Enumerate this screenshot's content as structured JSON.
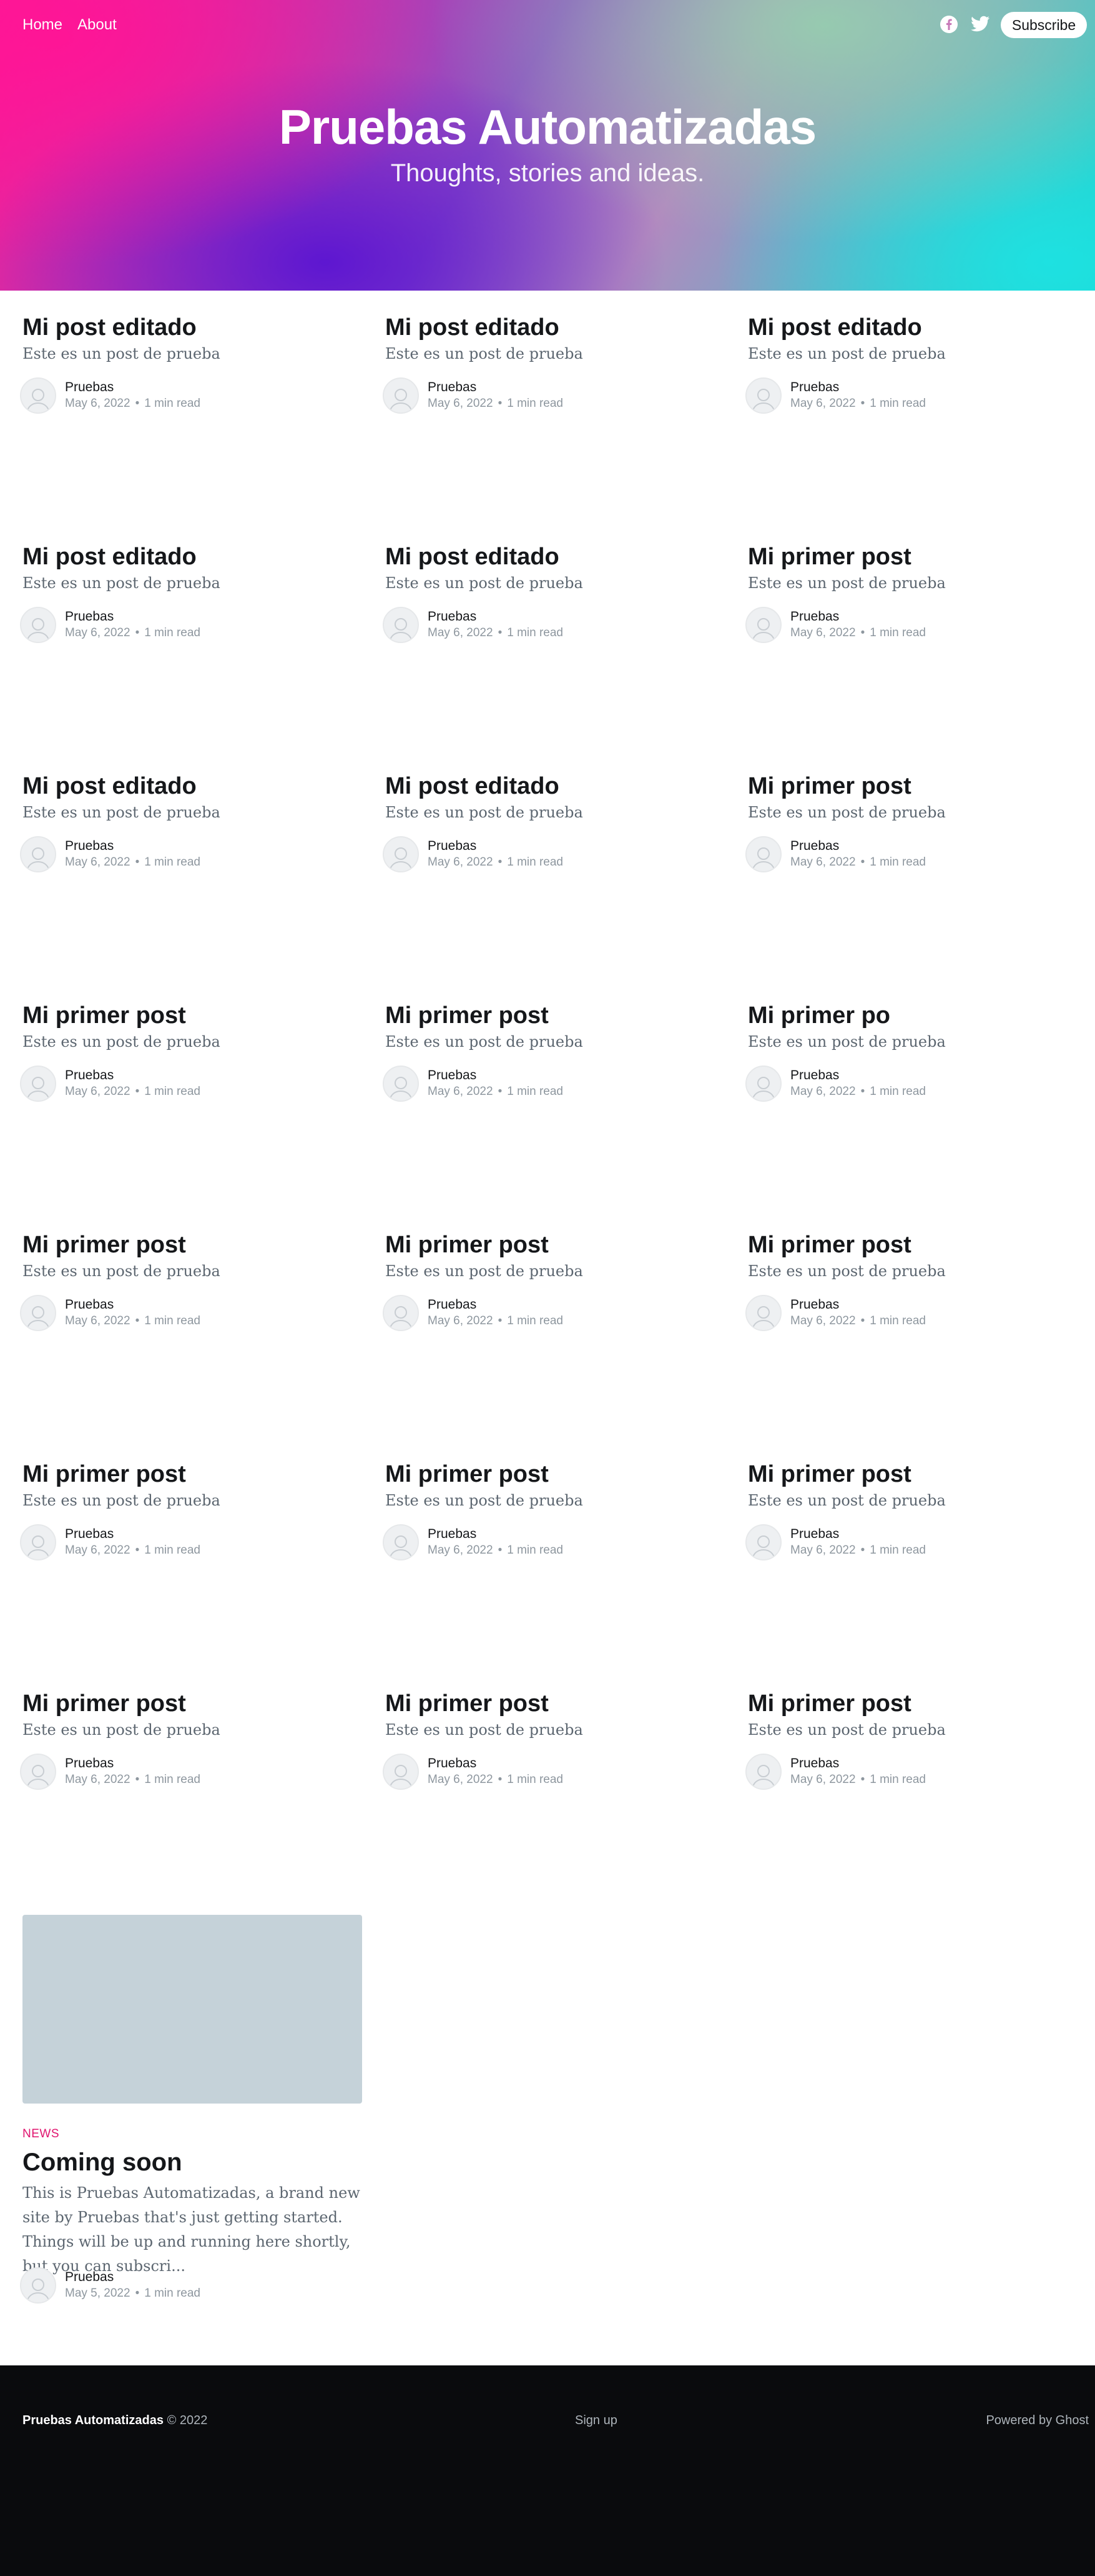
{
  "header": {
    "nav": [
      "Home",
      "About"
    ],
    "social_icons": [
      "facebook-icon",
      "twitter-icon"
    ],
    "subscribe_label": "Subscribe",
    "site_title": "Pruebas Automatizadas",
    "site_description": "Thoughts, stories and ideas."
  },
  "posts": [
    {
      "title": "Mi post editado",
      "excerpt": "Este es un post de prueba",
      "author": "Pruebas",
      "date": "May 6, 2022",
      "read": "1 min read"
    },
    {
      "title": "Mi post editado",
      "excerpt": "Este es un post de prueba",
      "author": "Pruebas",
      "date": "May 6, 2022",
      "read": "1 min read"
    },
    {
      "title": "Mi post editado",
      "excerpt": "Este es un post de prueba",
      "author": "Pruebas",
      "date": "May 6, 2022",
      "read": "1 min read"
    },
    {
      "title": "Mi post editado",
      "excerpt": "Este es un post de prueba",
      "author": "Pruebas",
      "date": "May 6, 2022",
      "read": "1 min read"
    },
    {
      "title": "Mi post editado",
      "excerpt": "Este es un post de prueba",
      "author": "Pruebas",
      "date": "May 6, 2022",
      "read": "1 min read"
    },
    {
      "title": "Mi primer post",
      "excerpt": "Este es un post de prueba",
      "author": "Pruebas",
      "date": "May 6, 2022",
      "read": "1 min read"
    },
    {
      "title": "Mi post editado",
      "excerpt": "Este es un post de prueba",
      "author": "Pruebas",
      "date": "May 6, 2022",
      "read": "1 min read"
    },
    {
      "title": "Mi post editado",
      "excerpt": "Este es un post de prueba",
      "author": "Pruebas",
      "date": "May 6, 2022",
      "read": "1 min read"
    },
    {
      "title": "Mi primer post",
      "excerpt": "Este es un post de prueba",
      "author": "Pruebas",
      "date": "May 6, 2022",
      "read": "1 min read"
    },
    {
      "title": "Mi primer post",
      "excerpt": "Este es un post de prueba",
      "author": "Pruebas",
      "date": "May 6, 2022",
      "read": "1 min read"
    },
    {
      "title": "Mi primer post",
      "excerpt": "Este es un post de prueba",
      "author": "Pruebas",
      "date": "May 6, 2022",
      "read": "1 min read"
    },
    {
      "title": "Mi primer po",
      "excerpt": "Este es un post de prueba",
      "author": "Pruebas",
      "date": "May 6, 2022",
      "read": "1 min read"
    },
    {
      "title": "Mi primer post",
      "excerpt": "Este es un post de prueba",
      "author": "Pruebas",
      "date": "May 6, 2022",
      "read": "1 min read"
    },
    {
      "title": "Mi primer post",
      "excerpt": "Este es un post de prueba",
      "author": "Pruebas",
      "date": "May 6, 2022",
      "read": "1 min read"
    },
    {
      "title": "Mi primer post",
      "excerpt": "Este es un post de prueba",
      "author": "Pruebas",
      "date": "May 6, 2022",
      "read": "1 min read"
    },
    {
      "title": "Mi primer post",
      "excerpt": "Este es un post de prueba",
      "author": "Pruebas",
      "date": "May 6, 2022",
      "read": "1 min read"
    },
    {
      "title": "Mi primer post",
      "excerpt": "Este es un post de prueba",
      "author": "Pruebas",
      "date": "May 6, 2022",
      "read": "1 min read"
    },
    {
      "title": "Mi primer post",
      "excerpt": "Este es un post de prueba",
      "author": "Pruebas",
      "date": "May 6, 2022",
      "read": "1 min read"
    },
    {
      "title": "Mi primer post",
      "excerpt": "Este es un post de prueba",
      "author": "Pruebas",
      "date": "May 6, 2022",
      "read": "1 min read"
    },
    {
      "title": "Mi primer post",
      "excerpt": "Este es un post de prueba",
      "author": "Pruebas",
      "date": "May 6, 2022",
      "read": "1 min read"
    },
    {
      "title": "Mi primer post",
      "excerpt": "Este es un post de prueba",
      "author": "Pruebas",
      "date": "May 6, 2022",
      "read": "1 min read"
    }
  ],
  "featured": {
    "tag": "NEWS",
    "title": "Coming soon",
    "excerpt": "This is Pruebas Automatizadas, a brand new site by Pruebas that's just getting started. Things will be up and running here shortly, but you can subscri...",
    "author": "Pruebas",
    "date": "May 5, 2022",
    "read": "1 min read"
  },
  "footer": {
    "site_name": "Pruebas Automatizadas",
    "copyright": "© 2022",
    "signup": "Sign up",
    "powered": "Powered by Ghost"
  },
  "colors": {
    "accent": "#e0136e",
    "footer_bg": "#0a0b0d",
    "placeholder_image": "#c5d2d9"
  }
}
